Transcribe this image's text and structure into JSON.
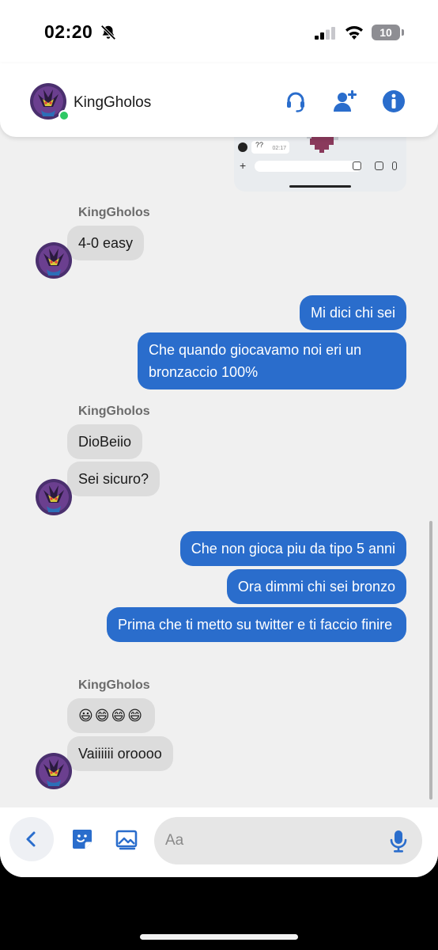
{
  "status_bar": {
    "time": "02:20",
    "battery": "10",
    "icons": [
      "bell-slash-icon",
      "signal-icon",
      "wifi-icon",
      "battery-icon"
    ]
  },
  "header": {
    "contact_name": "KingGholos",
    "online": true,
    "icons": [
      "voice-chat-icon",
      "add-friend-icon",
      "info-icon"
    ]
  },
  "screenshot_preview": {
    "chip_text": "??",
    "chip_time": "02:17"
  },
  "messages": {
    "group1": {
      "sender": "KingGholos",
      "items": [
        "4-0 easy"
      ]
    },
    "out1": [
      "Mi dici chi sei",
      "Che quando giocavamo noi eri un bronzaccio 100%"
    ],
    "group2": {
      "sender": "KingGholos",
      "items": [
        "DioBeiio",
        "Sei sicuro?"
      ]
    },
    "out2": [
      "Che non gioca piu da tipo 5 anni",
      "Ora dimmi chi sei bronzo",
      "Prima che ti metto su twitter e ti faccio finire"
    ],
    "group3": {
      "sender": "KingGholos",
      "items": [
        "😃😄😄😄",
        "Vaiiiiii oroooo"
      ]
    }
  },
  "composer": {
    "placeholder": "Aa",
    "icons": [
      "back-chevron-icon",
      "sticker-icon",
      "image-icon",
      "microphone-icon"
    ]
  },
  "colors": {
    "accent": "#2a6dcc",
    "incoming_bubble": "#dcdcdc",
    "background": "#f0f0f0",
    "online": "#2fc864"
  }
}
